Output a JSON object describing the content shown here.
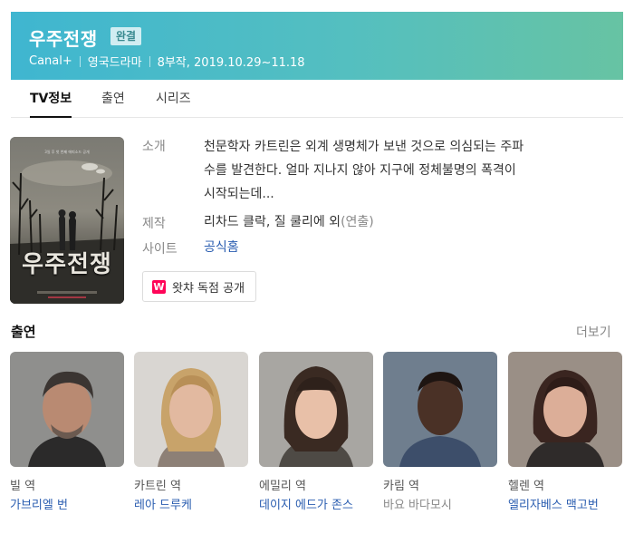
{
  "header": {
    "title": "우주전쟁",
    "badge": "완결",
    "meta": [
      "Canal+",
      "영국드라마",
      "8부작, 2019.10.29~11.18"
    ]
  },
  "tabs": [
    {
      "label": "TV정보",
      "active": true
    },
    {
      "label": "출연",
      "active": false
    },
    {
      "label": "시리즈",
      "active": false
    }
  ],
  "poster": {
    "title": "우주전쟁",
    "small_text": "3일 후 첫 번째 에피소드 공개"
  },
  "info": {
    "synopsis_label": "소개",
    "synopsis_lines": [
      "천문학자 카트린은 외계 생명체가 보낸 것으로 의심되는 주파",
      "수를 발견한다. 얼마 지나지 않아 지구에 정체불명의 폭격이",
      "시작되는데..."
    ],
    "production_label": "제작",
    "production_value": "리차드 클락, 질 쿨리에 외",
    "production_role": "(연출)",
    "site_label": "사이트",
    "site_link": "공식홈"
  },
  "watcha": {
    "icon": "W",
    "label": "왓챠 독점 공개"
  },
  "cast_section": {
    "title": "출연",
    "more": "더보기"
  },
  "cast": [
    {
      "role": "빌 역",
      "actor": "가브리엘 번",
      "linked": true
    },
    {
      "role": "카트린 역",
      "actor": "레아 드루케",
      "linked": true
    },
    {
      "role": "에밀리 역",
      "actor": "데이지 에드가 존스",
      "linked": true
    },
    {
      "role": "카림 역",
      "actor": "바요 바다모시",
      "linked": false
    },
    {
      "role": "헬렌 역",
      "actor": "엘리자베스 맥고번",
      "linked": true
    }
  ],
  "colors": {
    "header_gradient_start": "#3fb6d0",
    "header_gradient_end": "#67c3a3",
    "link": "#2a5db0",
    "watcha": "#ff0558"
  }
}
